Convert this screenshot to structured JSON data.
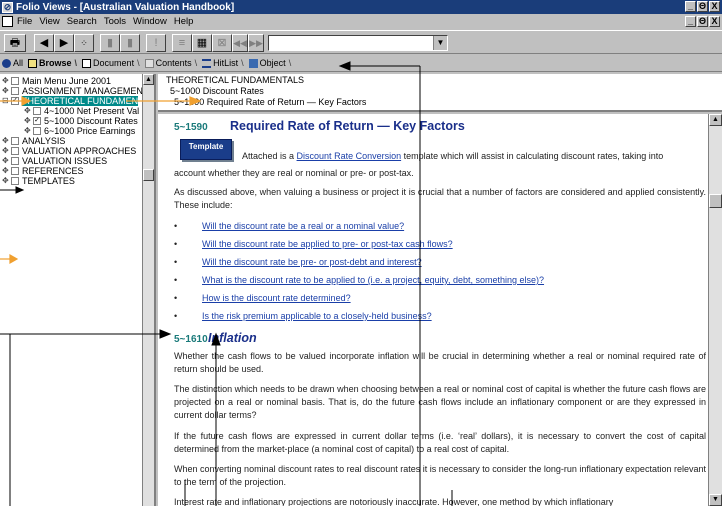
{
  "window": {
    "title": "Folio Views - [Australian Valuation Handbook]",
    "controls": [
      "_",
      "Θ",
      "X"
    ]
  },
  "menu": {
    "items": [
      "File",
      "View",
      "Search",
      "Tools",
      "Window",
      "Help"
    ]
  },
  "toolbar": {
    "buttons": [
      "print-icon",
      "back-icon",
      "forward-icon",
      "linked-icon",
      "prev-hit-icon",
      "next-hit-icon",
      "stop-icon",
      "edit-icon",
      "query-icon",
      "query2-icon",
      "first-hit-icon",
      "last-hit-icon"
    ],
    "search_value": ""
  },
  "tabs": [
    {
      "label": "All",
      "icon": "all-icon"
    },
    {
      "label": "Browse",
      "icon": "book-icon"
    },
    {
      "label": "Document",
      "icon": "document-icon"
    },
    {
      "label": "Contents",
      "icon": "contents-icon"
    },
    {
      "label": "HitList",
      "icon": "hitlist-icon"
    },
    {
      "label": "Object",
      "icon": "object-icon"
    }
  ],
  "tree": {
    "items": [
      {
        "label": "Main Menu June 2001",
        "checked": false,
        "expand": "+",
        "indent": 0
      },
      {
        "label": "ASSIGNMENT MANAGEMEN",
        "checked": false,
        "expand": "+",
        "indent": 0
      },
      {
        "label": "THEORETICAL FUNDAMEN",
        "checked": true,
        "expand": "-",
        "indent": 0,
        "selected": true
      },
      {
        "label": "4~1000 Net Present Val",
        "checked": false,
        "expand": "+",
        "indent": 1
      },
      {
        "label": "5~1000 Discount Rates",
        "checked": true,
        "expand": "+",
        "indent": 1
      },
      {
        "label": "6~1000 Price Earnings",
        "checked": false,
        "expand": "+",
        "indent": 1
      },
      {
        "label": "ANALYSIS",
        "checked": false,
        "expand": "+",
        "indent": 0
      },
      {
        "label": "VALUATION APPROACHES",
        "checked": false,
        "expand": "+",
        "indent": 0
      },
      {
        "label": "VALUATION ISSUES",
        "checked": false,
        "expand": "+",
        "indent": 0
      },
      {
        "label": "REFERENCES",
        "checked": false,
        "expand": "+",
        "indent": 0
      },
      {
        "label": "TEMPLATES",
        "checked": false,
        "expand": "+",
        "indent": 0
      }
    ]
  },
  "context": {
    "lines": [
      "THEORETICAL FUNDAMENTALS",
      "5~1000 Discount Rates",
      "5~1590 Required Rate of Return — Key Factors"
    ]
  },
  "document": {
    "section1_num": "5~1590",
    "section1_title": "Required Rate of Return — Key Factors",
    "template_badge": "Template",
    "p1_a": "Attached is a ",
    "p1_link": "Discount Rate Conversion",
    "p1_b": " template which will assist in calculating discount rates, taking into",
    "p1_line2": "account whether they are real or nominal or pre- or post-tax.",
    "p2": "As discussed above, when valuing a business or project it is crucial that a number of factors are considered and applied consistently. These include:",
    "bullets": [
      "Will the discount rate be a real or a nominal value?",
      "Will the discount rate be applied to pre- or post-tax cash flows?",
      "Will the discount rate be pre- or post-debt and interest?",
      "What is the discount rate to be applied to (i.e. a project, equity, debt, something else)?",
      "How is the discount rate determined?",
      "Is the risk premium applicable to a closely-held business?"
    ],
    "bullet_char": "•",
    "section2_num": "5~1610",
    "section2_title": "Inflation",
    "p3": "Whether the cash flows to be valued incorporate inflation will be crucial in determining whether a real or nominal required rate of return should be used.",
    "p4": "The distinction which needs to be drawn when choosing between a real or nominal cost of capital is whether the future cash flows are projected on a real or nominal basis. That is, do the future cash flows include an inflationary component or are they expressed in current dollar terms?",
    "p5": "If the future cash flows are expressed in current dollar terms (i.e. ‘real’ dollars), it is necessary to convert the cost of capital determined from the market-place (a nominal cost of capital) to a real cost of capital.",
    "p6": "When converting nominal discount rates to real discount rates it is necessary to consider the long-run inflationary expectation relevant to the term of the projection.",
    "p7": "Interest rate and inflationary projections are notoriously inaccurate. However, one method by which inflationary"
  },
  "colors": {
    "title_bar": "#1a3d7a",
    "selection": "#008a8a",
    "heading": "#1a2f8a",
    "link": "#1a3fa8",
    "callout_orange": "#f0a030"
  }
}
